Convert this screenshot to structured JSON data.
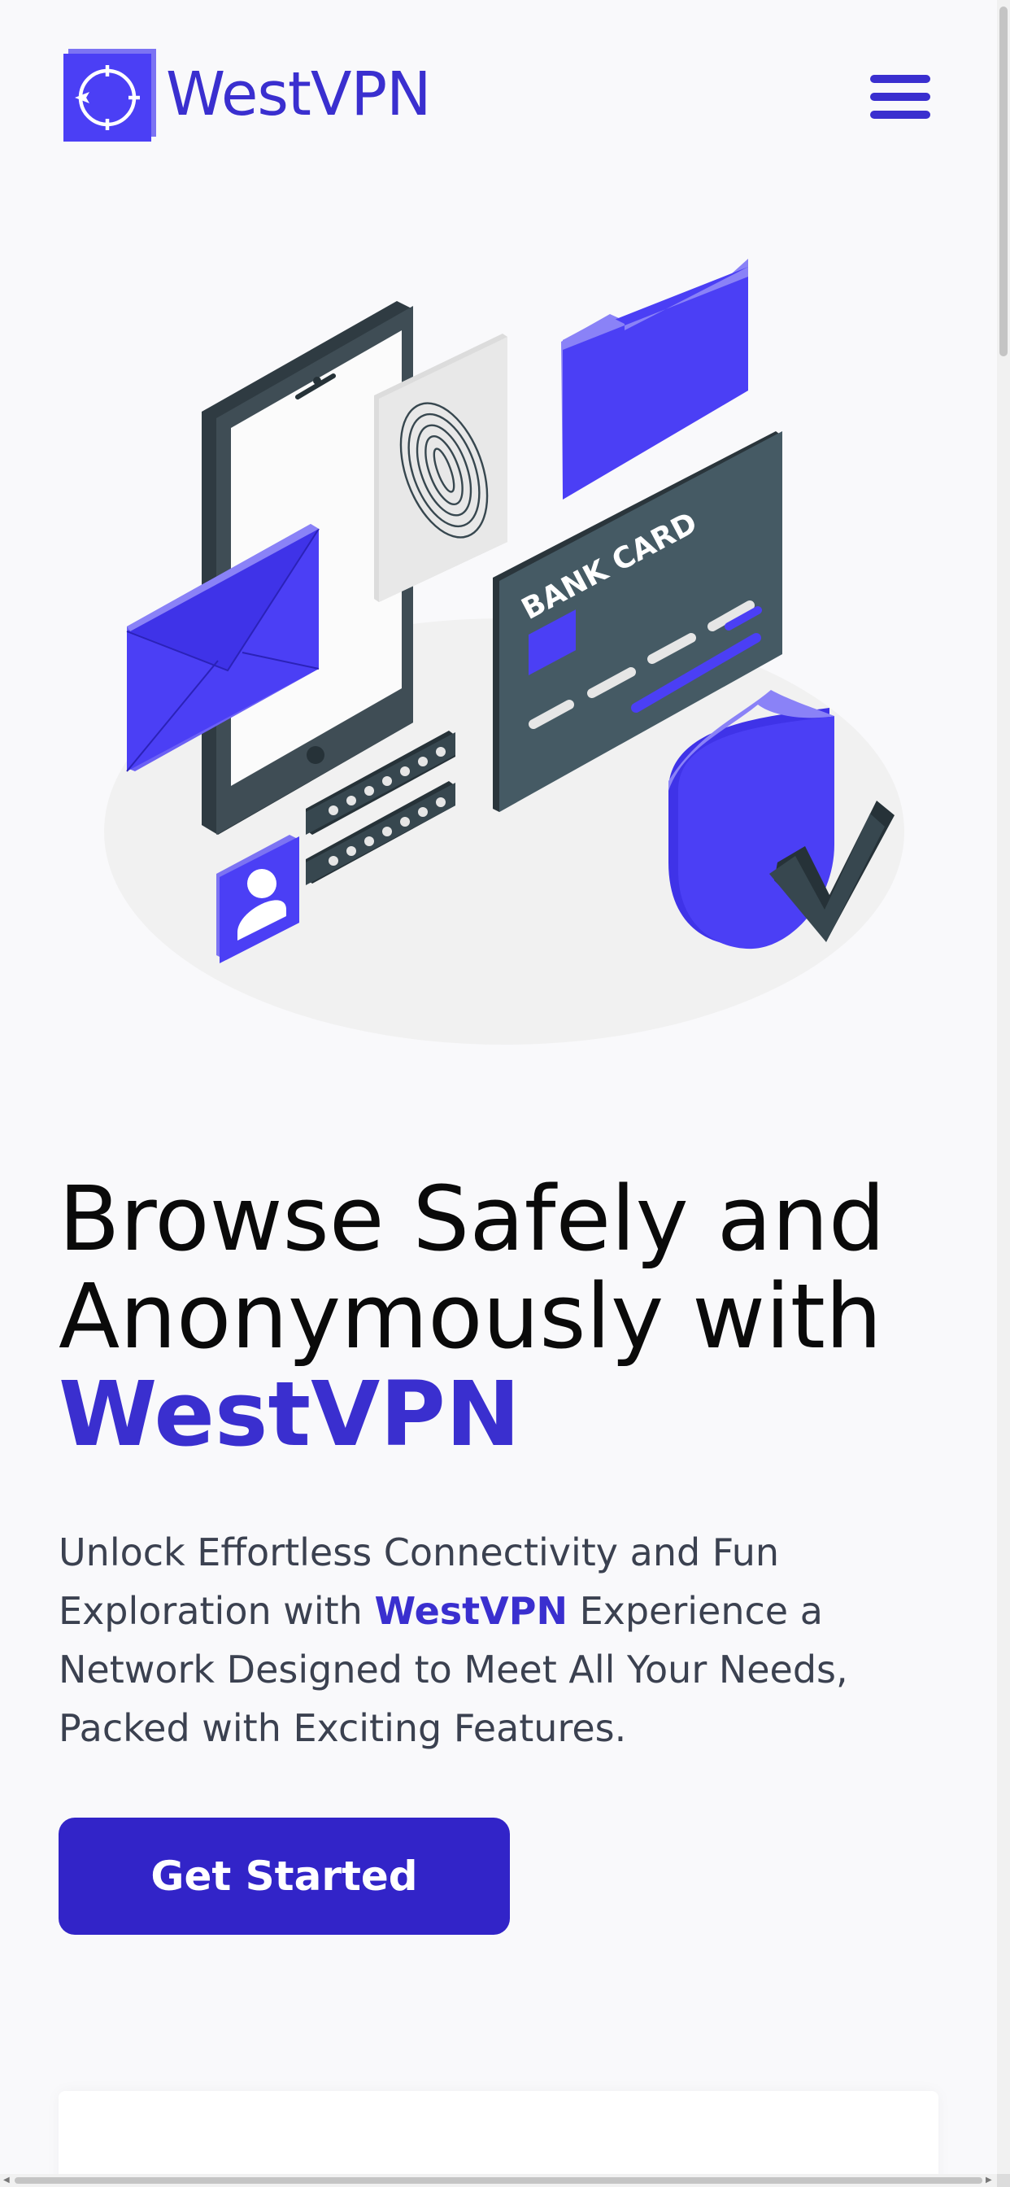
{
  "header": {
    "brand_name": "WestVPN",
    "logo_icon": "crosshair-compass-icon",
    "menu_icon": "hamburger-menu-icon"
  },
  "illustration": {
    "card_label": "BANK CARD",
    "elements": [
      "tablet",
      "fingerprint-card",
      "folder",
      "envelope",
      "bank-card",
      "password-fields",
      "user-badge",
      "shield-check"
    ]
  },
  "hero": {
    "title_line1": "Browse Safely and",
    "title_line2": "Anonymously with",
    "title_brand": "WestVPN",
    "desc_part1": "Unlock Effortless Connectivity and Fun Exploration with ",
    "desc_brand": "WestVPN",
    "desc_part2": " Experience a Network Designed to Meet All Your Needs, Packed with Exciting Features.",
    "cta_label": "Get Started"
  },
  "colors": {
    "brand": "#3a2fcf",
    "accent": "#4b3ff5",
    "dark": "#37474f",
    "background": "#f9f9fb"
  }
}
